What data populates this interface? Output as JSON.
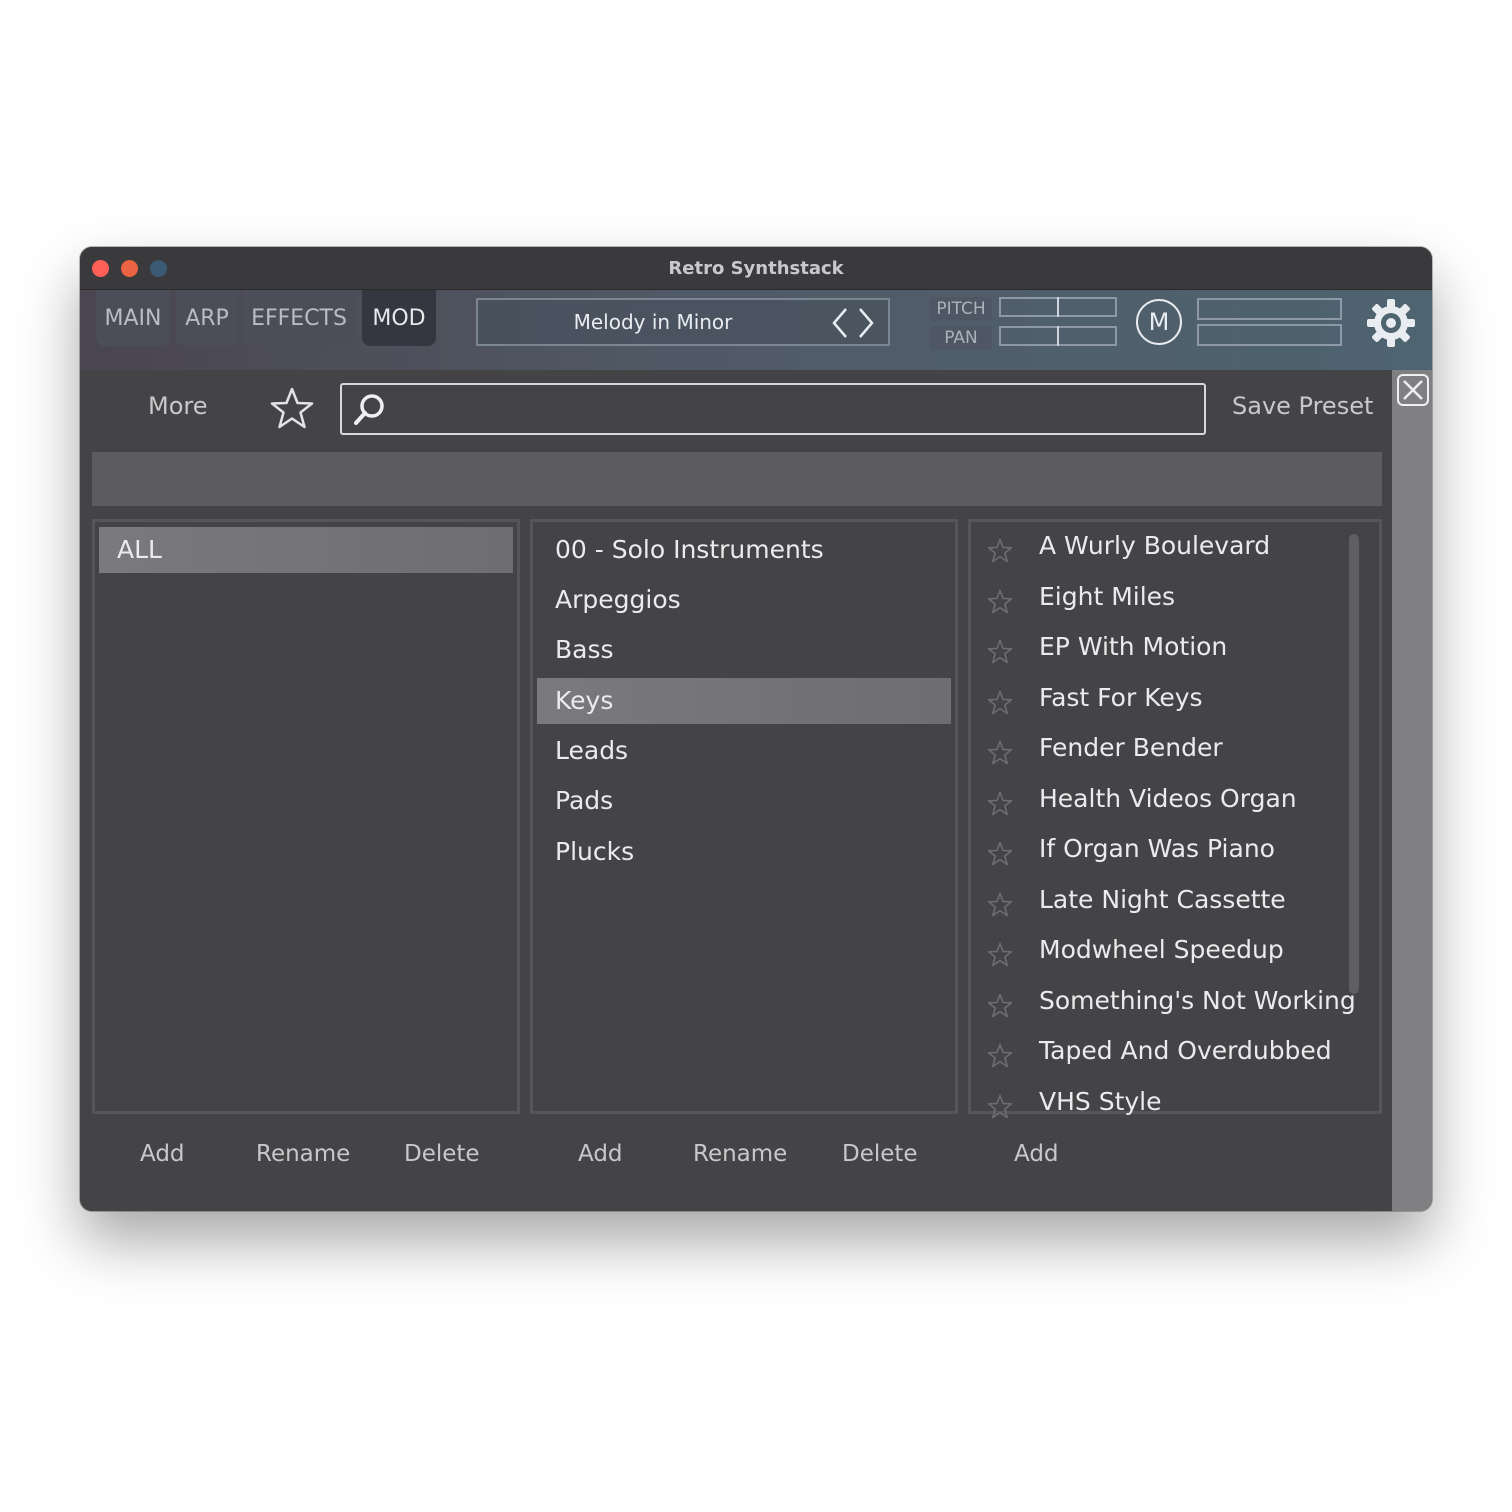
{
  "window": {
    "title": "Retro Synthstack"
  },
  "tabs": [
    {
      "label": "MAIN"
    },
    {
      "label": "ARP"
    },
    {
      "label": "EFFECTS"
    },
    {
      "label": "MOD"
    }
  ],
  "active_tab": "MOD",
  "preset": {
    "name": "Melody in Minor"
  },
  "pitch_label": "PITCH",
  "pan_label": "PAN",
  "m_button": "M",
  "browser": {
    "more_label": "More",
    "search": {
      "value": "",
      "placeholder": ""
    },
    "save_preset_label": "Save Preset",
    "banks": [
      {
        "label": "ALL",
        "selected": true
      }
    ],
    "categories": [
      {
        "label": "00 - Solo Instruments"
      },
      {
        "label": "Arpeggios"
      },
      {
        "label": "Bass"
      },
      {
        "label": "Keys",
        "selected": true
      },
      {
        "label": "Leads"
      },
      {
        "label": "Pads"
      },
      {
        "label": "Plucks"
      }
    ],
    "presets": [
      {
        "label": "A Wurly Boulevard"
      },
      {
        "label": "Eight Miles"
      },
      {
        "label": "EP With Motion"
      },
      {
        "label": "Fast For Keys"
      },
      {
        "label": "Fender Bender"
      },
      {
        "label": "Health Videos Organ"
      },
      {
        "label": "If Organ Was Piano"
      },
      {
        "label": "Late Night Cassette"
      },
      {
        "label": "Modwheel Speedup"
      },
      {
        "label": "Something's Not Working"
      },
      {
        "label": "Taped And Overdubbed"
      },
      {
        "label": "VHS Style"
      }
    ],
    "footer": {
      "bank_add": "Add",
      "bank_rename": "Rename",
      "bank_delete": "Delete",
      "cat_add": "Add",
      "cat_rename": "Rename",
      "cat_delete": "Delete",
      "preset_add": "Add"
    }
  },
  "icons": {
    "favorite": "star-icon",
    "search": "search-icon",
    "close": "close-icon",
    "settings": "gear-icon",
    "nav": "chevron-left-right-icon"
  },
  "colors": {
    "window_bg": "#444446",
    "selected_row": "#7a7a7c",
    "text": "#ebebed"
  }
}
